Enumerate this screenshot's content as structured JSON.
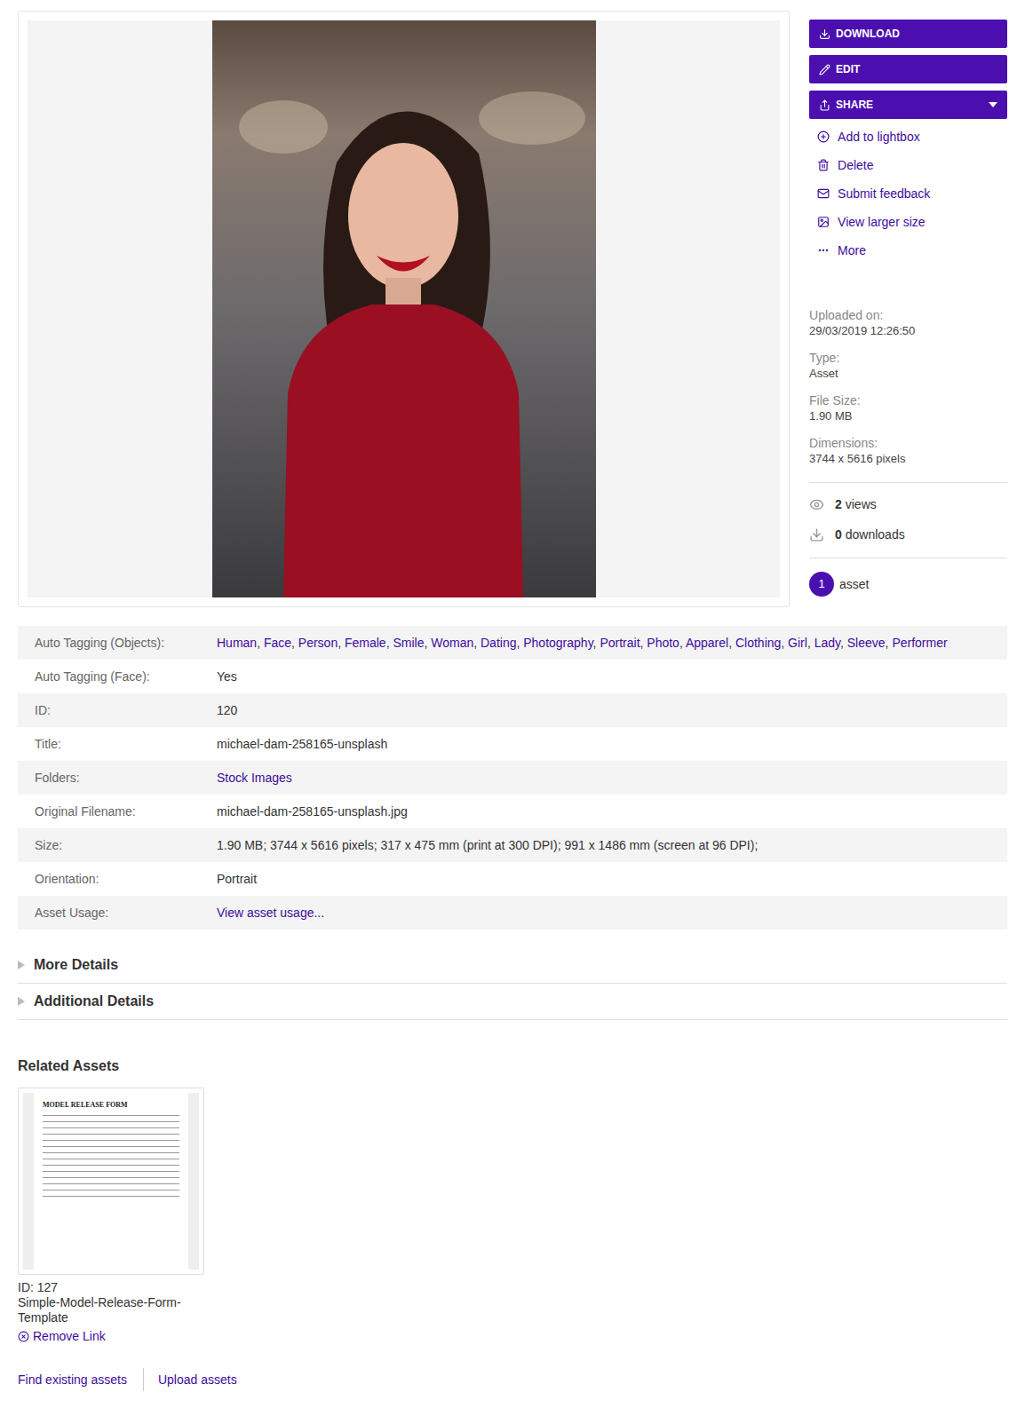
{
  "actions": {
    "buttons": [
      {
        "label": "DOWNLOAD",
        "dropdown": false
      },
      {
        "label": "EDIT",
        "dropdown": false
      },
      {
        "label": "SHARE",
        "dropdown": true
      }
    ],
    "links": [
      "Add to lightbox",
      "Delete",
      "Submit feedback",
      "View larger size",
      "More"
    ]
  },
  "info": [
    {
      "label": "Uploaded on:",
      "value": "29/03/2019 12:26:50"
    },
    {
      "label": "Type:",
      "value": "Asset"
    },
    {
      "label": "File Size:",
      "value": "1.90 MB"
    },
    {
      "label": "Dimensions:",
      "value": "3744 x 5616 pixels"
    }
  ],
  "stats": [
    {
      "count": "2",
      "label": "views"
    },
    {
      "count": "0",
      "label": "downloads"
    }
  ],
  "badge": {
    "count": "1",
    "label": "asset"
  },
  "details": [
    {
      "label": "Auto Tagging (Objects):",
      "kind": "tags",
      "separator": ",",
      "values": [
        "Human",
        "Face",
        "Person",
        "Female",
        "Smile",
        "Woman",
        "Dating",
        "Photography",
        "Portrait",
        "Photo",
        "Apparel",
        "Clothing",
        "Girl",
        "Lady",
        "Sleeve",
        "Performer"
      ]
    },
    {
      "label": "Auto Tagging (Face):",
      "kind": "text",
      "value": "Yes"
    },
    {
      "label": "ID:",
      "kind": "text",
      "value": "120"
    },
    {
      "label": "Title:",
      "kind": "text",
      "value": "michael-dam-258165-unsplash"
    },
    {
      "label": "Folders:",
      "kind": "link",
      "value": "Stock Images"
    },
    {
      "label": "Original Filename:",
      "kind": "text",
      "value": "michael-dam-258165-unsplash.jpg"
    },
    {
      "label": "Size:",
      "kind": "text",
      "value": "1.90 MB; 3744 x 5616 pixels; 317 x 475 mm (print at 300 DPI); 991 x 1486 mm (screen at 96 DPI);"
    },
    {
      "label": "Orientation:",
      "kind": "text",
      "value": "Portrait"
    },
    {
      "label": "Asset Usage:",
      "kind": "link",
      "value": "View asset usage..."
    }
  ],
  "sections": [
    {
      "label": "More Details",
      "expanded": false
    },
    {
      "label": "Additional Details",
      "expanded": false
    }
  ],
  "related": {
    "title": "Related Assets",
    "assets": [
      {
        "id": "ID: 127",
        "name": "Simple-Model-Release-Form-Template",
        "thumbnail_title": "MODEL RELEASE FORM",
        "action": "Remove Link"
      }
    ]
  },
  "footer_links": [
    "Find existing assets",
    "Upload assets"
  ]
}
